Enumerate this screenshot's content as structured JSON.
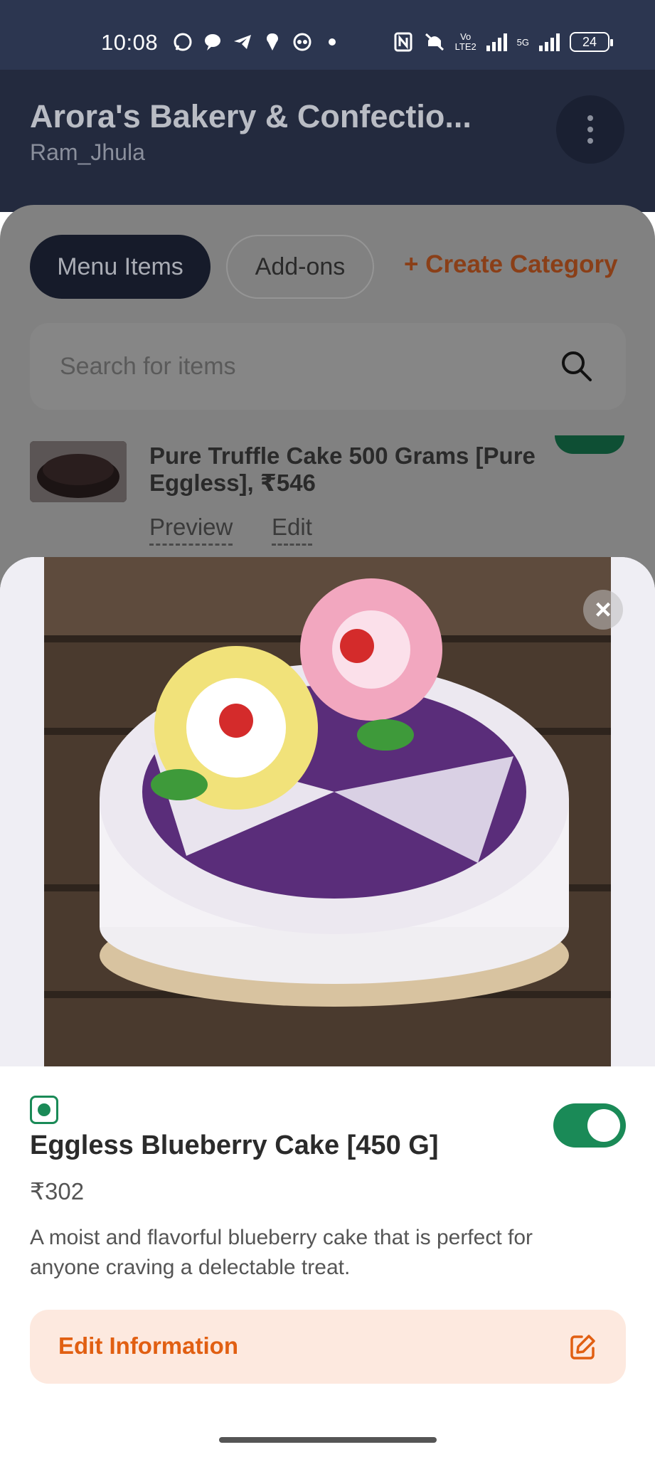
{
  "status_bar": {
    "time": "10:08",
    "battery": "24",
    "network_label": "Vo LTE2",
    "fiveg_label": "5G"
  },
  "header": {
    "title": "Arora's Bakery & Confectio...",
    "subtitle": "Ram_Jhula"
  },
  "tabs": {
    "menu_items": "Menu Items",
    "addons": "Add-ons",
    "create_category": "+ Create Category"
  },
  "search": {
    "placeholder": "Search for items"
  },
  "background_item": {
    "name": "Pure Truffle Cake 500 Grams [Pure Eggless], ₹546",
    "preview_label": "Preview",
    "edit_label": "Edit"
  },
  "modal": {
    "close_glyph": "×",
    "product_name": "Eggless Blueberry Cake [450 G]",
    "price": "₹302",
    "description": "A moist and flavorful blueberry cake that is perfect for anyone craving a delectable treat.",
    "available": true,
    "edit_button_label": "Edit Information"
  },
  "colors": {
    "accent_orange": "#e15f12",
    "veg_green": "#1a8a57",
    "status_bar": "#2c3650"
  },
  "icons": [
    "whatsapp-icon",
    "chat-icon",
    "telegram-icon",
    "swiggy-icon",
    "app-icon",
    "nfc-icon",
    "mute-icon",
    "signal-icon",
    "battery-icon",
    "kebab-menu-icon",
    "search-icon",
    "close-icon",
    "veg-indicator-icon",
    "edit-icon"
  ]
}
